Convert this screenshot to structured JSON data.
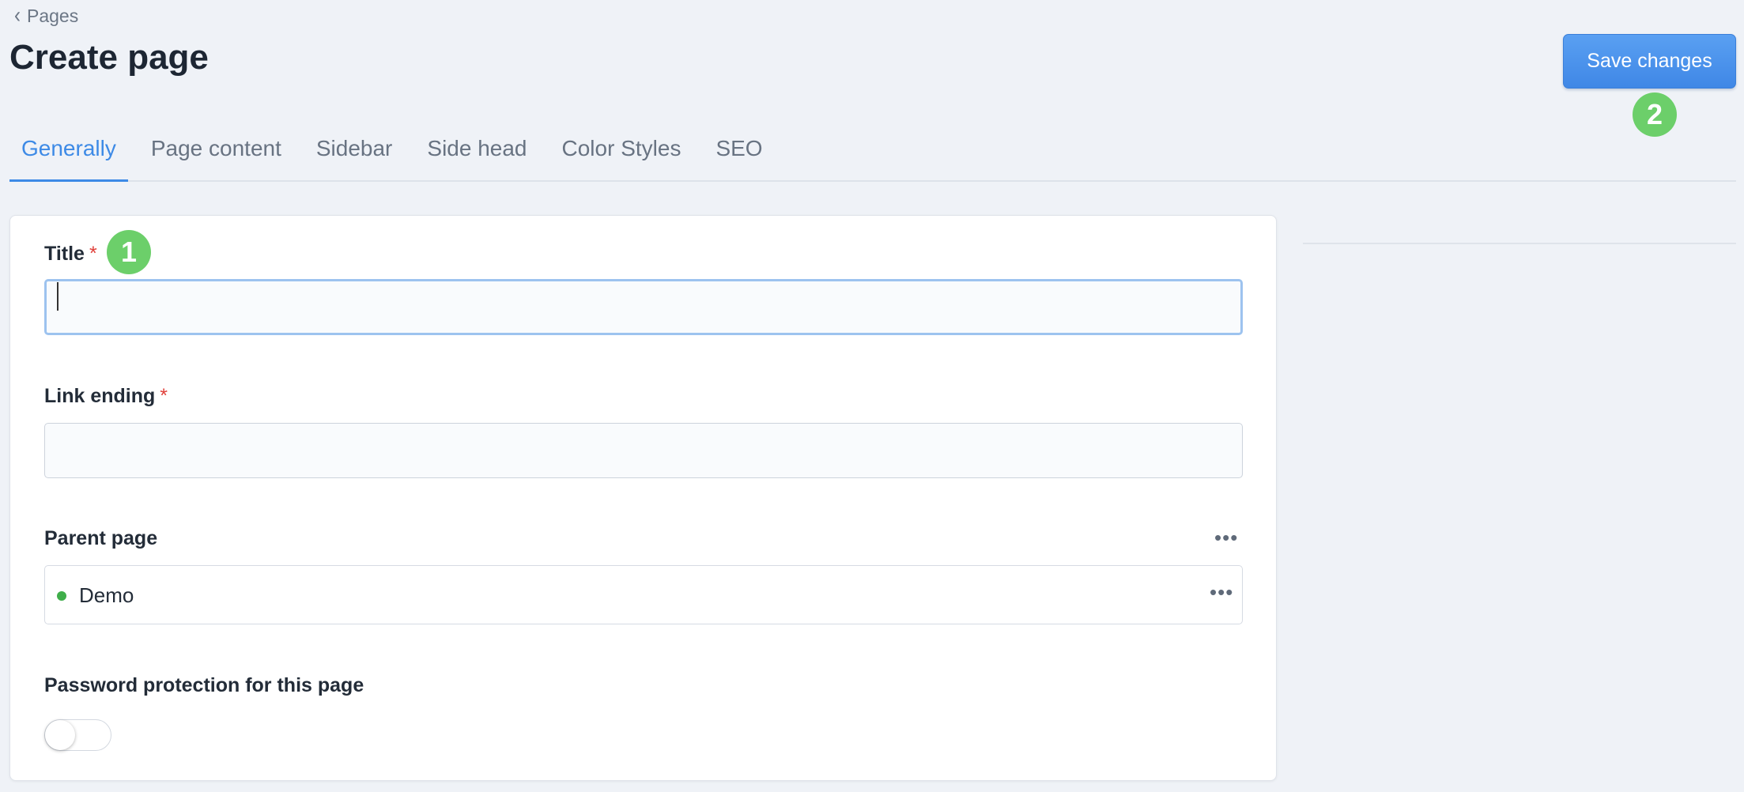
{
  "breadcrumb": {
    "label": "Pages"
  },
  "header": {
    "title": "Create page",
    "save_label": "Save changes"
  },
  "markers": {
    "first": "1",
    "second": "2"
  },
  "tabs": [
    {
      "label": "Generally",
      "active": true
    },
    {
      "label": "Page content"
    },
    {
      "label": "Sidebar"
    },
    {
      "label": "Side head"
    },
    {
      "label": "Color Styles"
    },
    {
      "label": "SEO"
    }
  ],
  "form": {
    "title_label": "Title",
    "title_value": "",
    "required_mark": "*",
    "link_label": "Link ending",
    "link_value": "",
    "parent_label": "Parent page",
    "parent_value": "Demo",
    "parent_status_color": "#3fae4a",
    "password_label": "Password protection for this page",
    "password_enabled": false
  },
  "colors": {
    "accent": "#3d8ae6",
    "marker": "#6ccf6a",
    "required": "#e0413b"
  }
}
